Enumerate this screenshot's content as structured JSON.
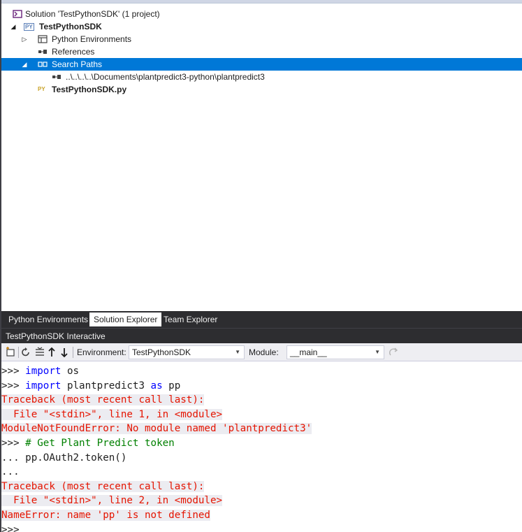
{
  "solution_explorer": {
    "solution_label": "Solution 'TestPythonSDK' (1 project)",
    "project_label": "TestPythonSDK",
    "project_badge": "PY",
    "items": {
      "python_environments": "Python Environments",
      "references": "References",
      "search_paths": "Search Paths",
      "search_path_entry": "..\\..\\..\\..\\Documents\\plantpredict3-python\\plantpredict3",
      "file": "TestPythonSDK.py",
      "file_badge": "PY"
    }
  },
  "tabs": [
    {
      "label": "Python Environments",
      "active": false
    },
    {
      "label": "Solution Explorer",
      "active": true
    },
    {
      "label": "Team Explorer",
      "active": false
    }
  ],
  "interactive": {
    "title": "TestPythonSDK Interactive",
    "environment_label": "Environment:",
    "environment_value": "TestPythonSDK",
    "module_label": "Module:",
    "module_value": "__main__"
  },
  "console": {
    "lines": [
      {
        "prompt": ">>> ",
        "kw": "import",
        "rest": " os"
      },
      {
        "prompt": ">>> ",
        "kw": "import",
        "rest": " plantpredict3 ",
        "kw2": "as",
        "rest2": " pp"
      },
      {
        "error": "Traceback (most recent call last):"
      },
      {
        "error": "  File \"<stdin>\", line 1, in <module>"
      },
      {
        "error": "ModuleNotFoundError: No module named 'plantpredict3'"
      },
      {
        "prompt": ">>> ",
        "comment": "# Get Plant Predict token"
      },
      {
        "prompt": "... ",
        "rest": "pp.OAuth2.token()"
      },
      {
        "prompt": "..."
      },
      {
        "error": "Traceback (most recent call last):"
      },
      {
        "error": "  File \"<stdin>\", line 2, in <module>"
      },
      {
        "error": "NameError: name 'pp' is not defined"
      },
      {
        "prompt": ">>>"
      }
    ]
  },
  "colors": {
    "selection": "#0078d7",
    "error_text": "#e51400",
    "keyword": "#0000ff",
    "comment": "#008000",
    "tool_window_dark": "#2d2d30"
  }
}
